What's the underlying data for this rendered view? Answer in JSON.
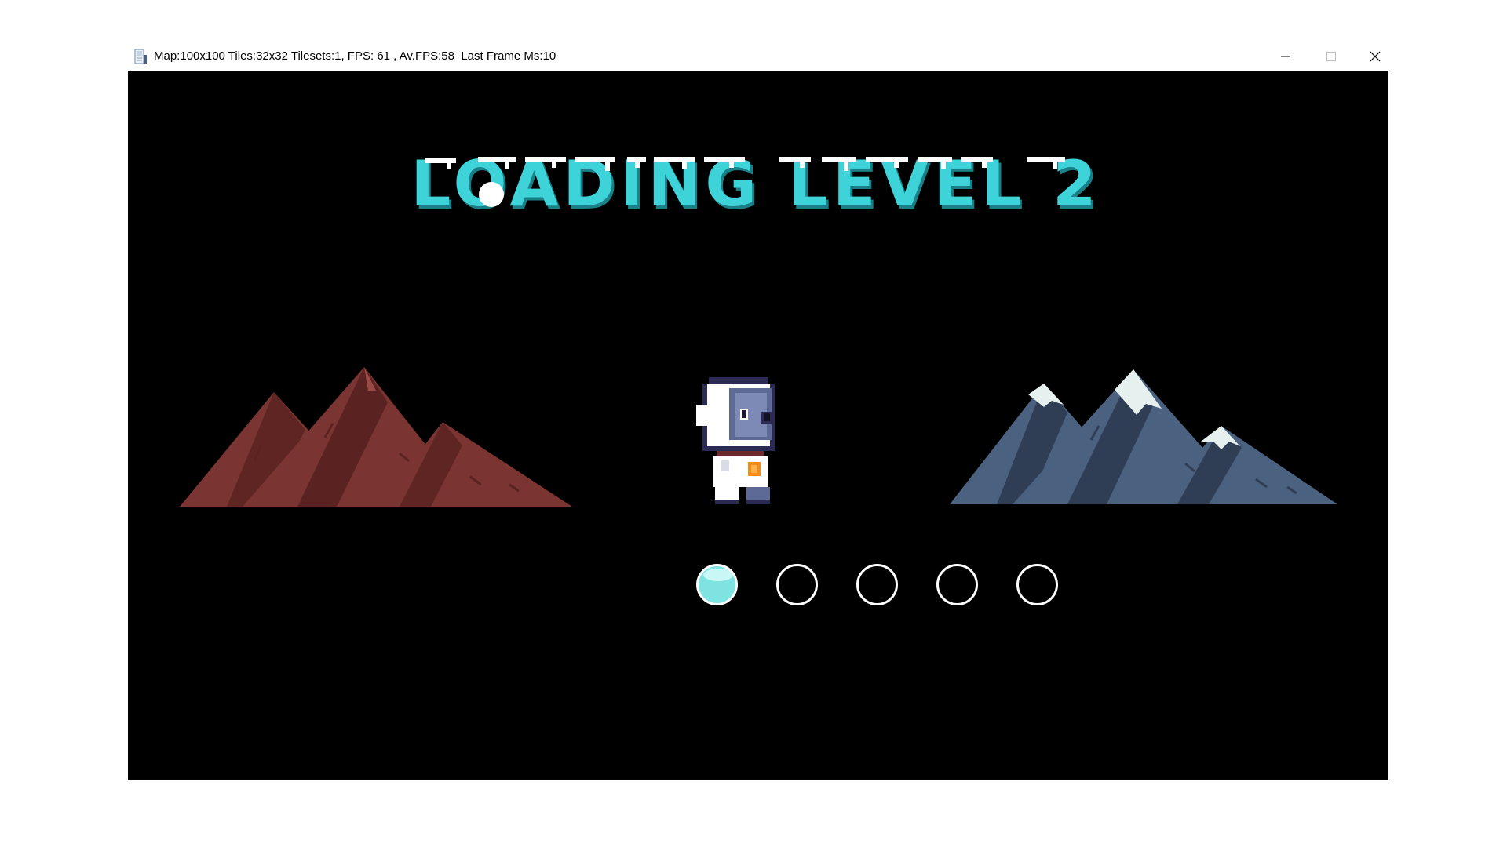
{
  "window": {
    "title": "Map:100x100 Tiles:32x32 Tilesets:1, FPS: 61 , Av.FPS:58  Last Frame Ms:10",
    "controls": {
      "minimize_icon": "minimize-icon",
      "maximize_icon": "maximize-icon",
      "close_icon": "close-icon"
    }
  },
  "game": {
    "loading_title": "LOADING LEVEL 2",
    "title_color": "#3ed3d9",
    "snow_color": "#ffffff",
    "left_scene": "red-mountains",
    "right_scene": "snowy-blue-mountains",
    "player_sprite": "astronaut-character",
    "progress": {
      "total": 5,
      "filled": 1,
      "fill_color": "#7fe3e2",
      "outline_color": "#ffffff"
    }
  }
}
